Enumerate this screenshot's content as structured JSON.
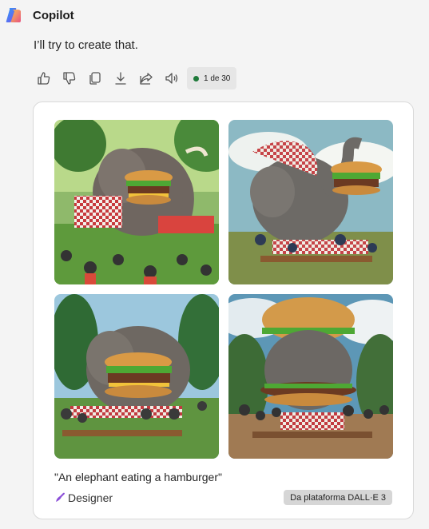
{
  "app": {
    "name": "Copilot"
  },
  "message": {
    "text": "I’ll try to create that."
  },
  "actions": {
    "like_icon": "thumbs-up-icon",
    "dislike_icon": "thumbs-down-icon",
    "copy_icon": "copy-icon",
    "download_icon": "download-icon",
    "share_icon": "share-icon",
    "read_aloud_icon": "speaker-icon",
    "counter_label": "1 de 30",
    "counter_dot_color": "#1f7a3a"
  },
  "result": {
    "images": [
      {
        "scene": "elephant-burger-picnic-1"
      },
      {
        "scene": "elephant-burger-picnic-2"
      },
      {
        "scene": "elephant-burger-picnic-3"
      },
      {
        "scene": "elephant-burger-picnic-4"
      }
    ],
    "prompt": "\"An elephant eating a hamburger\"",
    "creator": "Designer",
    "platform_badge": "Da plataforma DALL·E 3"
  },
  "colors": {
    "background": "#f4f4f4",
    "card": "#ffffff",
    "badge": "#d6d6d6"
  }
}
